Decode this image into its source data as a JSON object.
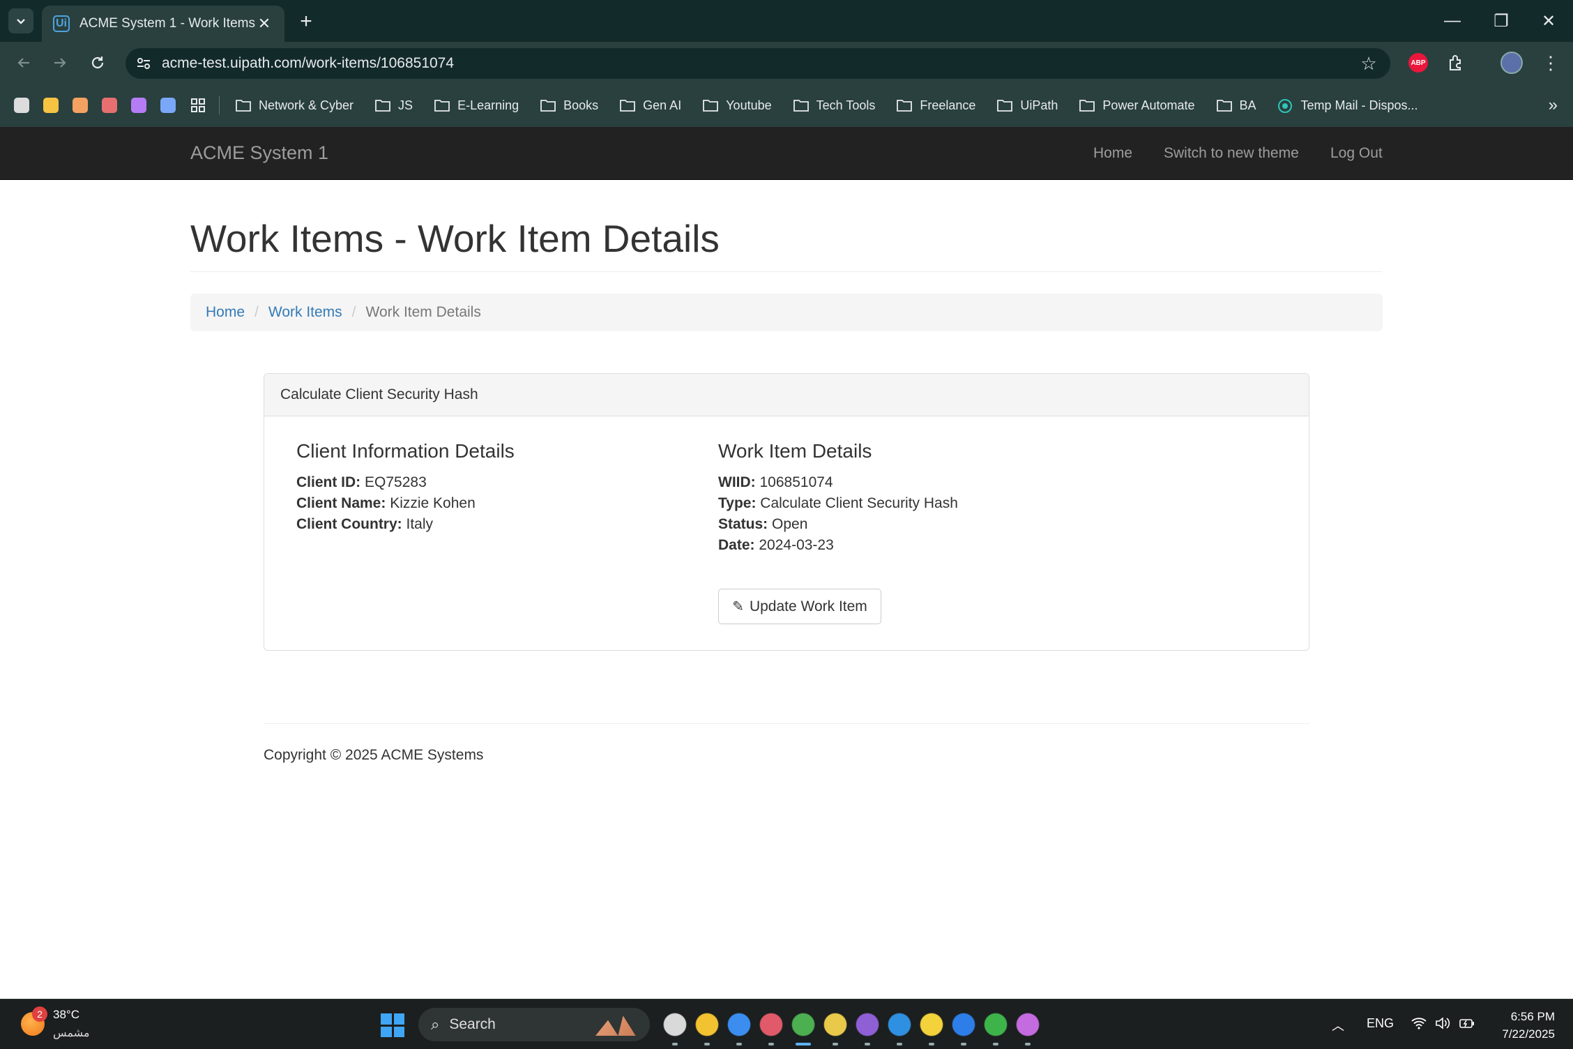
{
  "browser": {
    "tab_title": "ACME System 1 - Work Items",
    "tab_close": "✕",
    "new_tab": "+",
    "url": "acme-test.uipath.com/work-items/106851074",
    "window_controls": {
      "minimize": "—",
      "restore": "❐",
      "close": "✕"
    },
    "bookmark_apps": [
      "#dcdcdc",
      "#f6c343",
      "#f4a261",
      "#e76f6f",
      "#b57cf6",
      "#7aa7f7"
    ],
    "bookmarks": [
      {
        "label": "Network & Cyber",
        "icon": "folder-icon"
      },
      {
        "label": "JS",
        "icon": "folder-icon"
      },
      {
        "label": "E-Learning",
        "icon": "folder-icon"
      },
      {
        "label": "Books",
        "icon": "folder-icon"
      },
      {
        "label": "Gen AI",
        "icon": "folder-icon"
      },
      {
        "label": "Youtube",
        "icon": "folder-icon"
      },
      {
        "label": "Tech Tools",
        "icon": "folder-icon"
      },
      {
        "label": "Freelance",
        "icon": "folder-icon"
      },
      {
        "label": "UiPath",
        "icon": "folder-icon"
      },
      {
        "label": "Power Automate",
        "icon": "folder-icon"
      },
      {
        "label": "BA",
        "icon": "folder-icon"
      },
      {
        "label": "Temp Mail - Dispos...",
        "icon": "temp-mail-icon"
      }
    ],
    "abp_label": "ABP"
  },
  "navbar": {
    "brand": "ACME System 1",
    "links": [
      "Home",
      "Switch to new theme",
      "Log Out"
    ]
  },
  "page": {
    "title": "Work Items - Work Item Details",
    "breadcrumb": {
      "home": "Home",
      "work_items": "Work Items",
      "current": "Work Item Details",
      "separator": "/"
    },
    "panel_heading": "Calculate Client Security Hash",
    "client": {
      "heading": "Client Information Details",
      "rows": [
        {
          "label": "Client ID:",
          "value": "EQ75283"
        },
        {
          "label": "Client Name:",
          "value": "Kizzie Kohen"
        },
        {
          "label": "Client Country:",
          "value": "Italy"
        }
      ]
    },
    "work_item": {
      "heading": "Work Item Details",
      "rows": [
        {
          "label": "WIID:",
          "value": "106851074"
        },
        {
          "label": "Type:",
          "value": "Calculate Client Security Hash"
        },
        {
          "label": "Status:",
          "value": "Open"
        },
        {
          "label": "Date:",
          "value": "2024-03-23"
        }
      ]
    },
    "update_button": "Update Work Item",
    "copyright": "Copyright © 2025 ACME Systems"
  },
  "taskbar": {
    "weather_temp": "38°C",
    "weather_city": "مشمس",
    "weather_badge": "2",
    "search_placeholder": "Search",
    "language": "ENG",
    "time": "6:56 PM",
    "date": "7/22/2025",
    "pinned_apps": [
      {
        "name": "task-view",
        "color": "#d9d9d9"
      },
      {
        "name": "file-explorer",
        "color": "#f2c230"
      },
      {
        "name": "todo",
        "color": "#3b8ef0"
      },
      {
        "name": "snipping-tool",
        "color": "#e05a6a"
      },
      {
        "name": "chrome",
        "color": "#4caf50"
      },
      {
        "name": "picker",
        "color": "#e9c94a"
      },
      {
        "name": "visual-studio",
        "color": "#8f5fd6"
      },
      {
        "name": "vscode",
        "color": "#2f8fe0"
      },
      {
        "name": "sticky-notes",
        "color": "#f3d23c"
      },
      {
        "name": "uipath-studio",
        "color": "#2d7ee8"
      },
      {
        "name": "uipath-assistant",
        "color": "#3db34a"
      },
      {
        "name": "media-player",
        "color": "#c46be0"
      }
    ]
  }
}
